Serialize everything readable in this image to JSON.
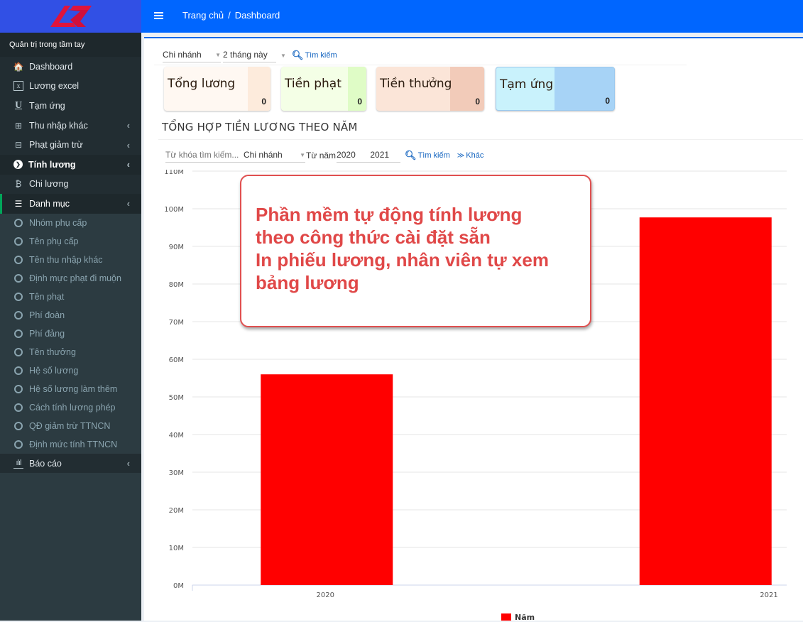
{
  "app": {
    "slogan": "Quản trị trong tầm tay",
    "logo_icon": "az-logo"
  },
  "topbar": {
    "menu_icon": "hamburger-icon",
    "breadcrumb": [
      "Trang chủ",
      "Dashboard"
    ],
    "separator": "/"
  },
  "sidebar": {
    "items": [
      {
        "label": "Dashboard",
        "icon": "home-icon",
        "glyph": "🏠"
      },
      {
        "label": "Lương excel",
        "icon": "excel-file-icon",
        "glyph": "x"
      },
      {
        "label": "Tạm ứng",
        "icon": "underline-icon",
        "glyph": "U"
      },
      {
        "label": "Thu nhập khác",
        "icon": "plus-square-icon",
        "glyph": "⊞",
        "chevron": "‹"
      },
      {
        "label": "Phạt giảm trừ",
        "icon": "minus-square-icon",
        "glyph": "⊟",
        "chevron": "‹"
      },
      {
        "label": "Tính lương",
        "icon": "chevron-circle-right-icon",
        "glyph": "❯",
        "chevron": "‹",
        "state": "active"
      },
      {
        "label": "Chi lương",
        "icon": "bitcoin-icon",
        "glyph": "₿"
      },
      {
        "label": "Danh mục",
        "icon": "list-icon",
        "glyph": "☰",
        "chevron": "‹",
        "state": "open"
      }
    ],
    "sub_items": [
      "Nhóm phụ cấp",
      "Tên phụ cấp",
      "Tên thu nhập khác",
      "Định mực phạt đi muộn",
      "Tên phạt",
      "Phí đoàn",
      "Phí đảng",
      "Tên thưởng",
      "Hệ số lương",
      "Hệ số lương làm thêm",
      "Cách tính lương phép",
      "QĐ giảm trừ TTNCN",
      "Định mức tính TTNCN"
    ],
    "report": {
      "label": "Báo cáo",
      "icon": "bar-chart-icon",
      "chevron": "‹"
    }
  },
  "filter_top": {
    "branch": "Chi nhánh",
    "period": "2 tháng này",
    "search": "Tìm kiếm"
  },
  "cards": [
    {
      "label": "Tổng lương",
      "value": "0",
      "bg": "#fff8f2",
      "strip": "#fdebdc"
    },
    {
      "label": "Tiền phạt",
      "value": "0",
      "bg": "#f4ffe6",
      "strip": "#dffcc6"
    },
    {
      "label": "Tiền thưởng",
      "value": "0",
      "bg": "#fbe5d8",
      "strip": "#f2cbb9"
    },
    {
      "label": "Tạm ứng",
      "value": "0",
      "bg": "#c9f2fc",
      "strip": "#a7d3f6"
    }
  ],
  "section": {
    "title": "TỔNG HỢP TIỀN LƯƠNG THEO NĂM"
  },
  "filter_chart": {
    "keyword_placeholder": "Từ khóa tìm kiếm...",
    "branch": "Chi nhánh",
    "from_label": "Từ năm",
    "from_year": "2020",
    "to_year": "2021",
    "search": "Tìm kiếm",
    "more": "Khác"
  },
  "callout": {
    "lines": [
      "Phần mềm tự động tính lương",
      "theo công thức cài đặt sẵn",
      "In phiếu lương, nhân viên tự xem",
      "bảng lương"
    ]
  },
  "chart_data": {
    "type": "bar",
    "title": "",
    "categories": [
      "2020",
      "2021"
    ],
    "series": [
      {
        "name": "Năm",
        "values": [
          56000000,
          97700000
        ],
        "color": "#ff0000"
      }
    ],
    "xlabel": "",
    "ylabel": "",
    "ylim": [
      0,
      110000000
    ],
    "yticks": [
      0,
      10000000,
      20000000,
      30000000,
      40000000,
      50000000,
      60000000,
      70000000,
      80000000,
      90000000,
      100000000,
      110000000
    ],
    "ytick_labels": [
      "0M",
      "10M",
      "20M",
      "30M",
      "40M",
      "50M",
      "60M",
      "70M",
      "80M",
      "90M",
      "100M",
      "110M"
    ],
    "grid": true,
    "legend": "bottom-center"
  }
}
